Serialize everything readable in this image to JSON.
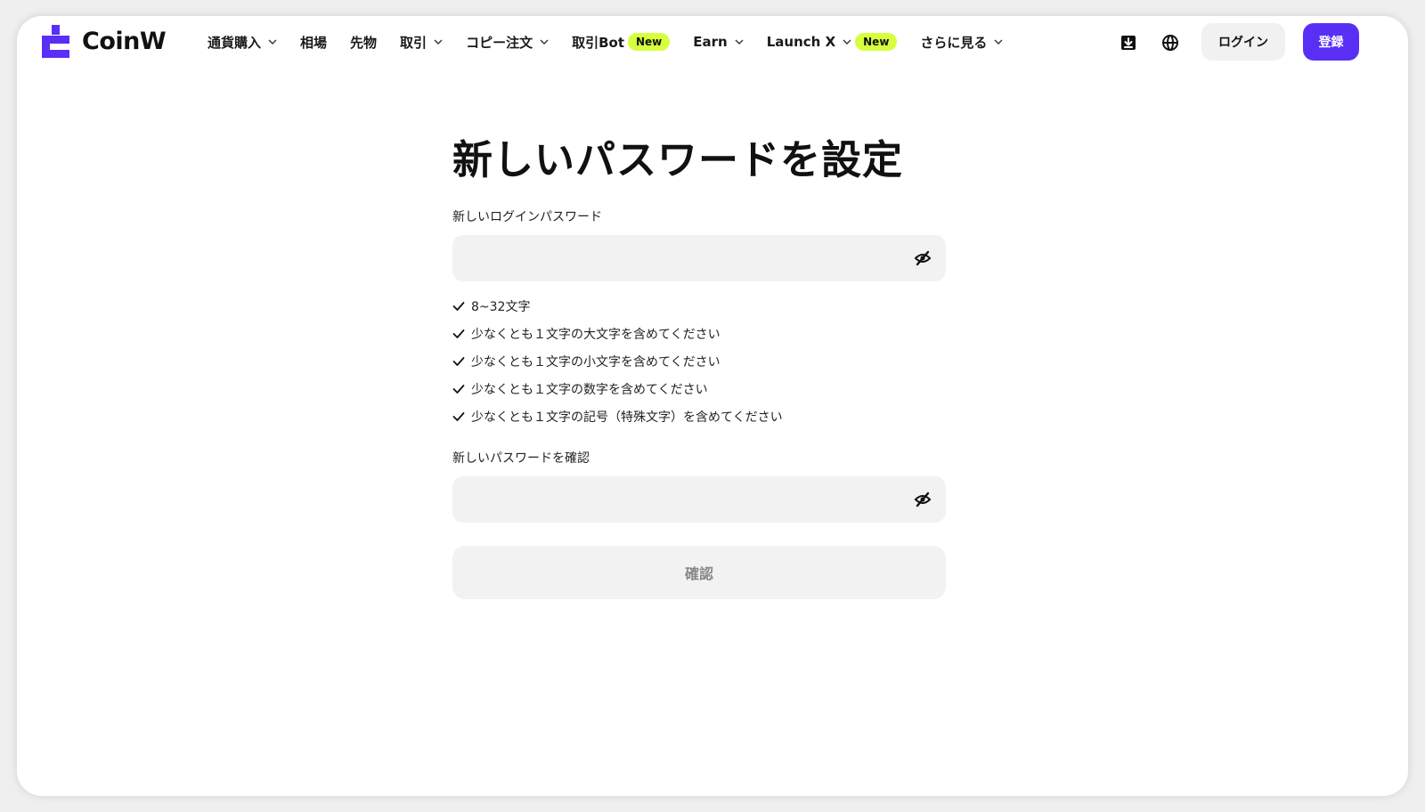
{
  "brand": {
    "name": "CoinW",
    "accent": "#5a2ff5",
    "badge_color": "#d6ff3d"
  },
  "nav": [
    {
      "label": "通貨購入",
      "dropdown": true
    },
    {
      "label": "相場",
      "dropdown": false
    },
    {
      "label": "先物",
      "dropdown": false
    },
    {
      "label": "取引",
      "dropdown": true
    },
    {
      "label": "コピー注文",
      "dropdown": true
    },
    {
      "label": "取引Bot",
      "dropdown": false,
      "badge": "New"
    },
    {
      "label": "Earn",
      "dropdown": true
    },
    {
      "label": "Launch X",
      "dropdown": true,
      "badge": "New"
    },
    {
      "label": "さらに見る",
      "dropdown": true
    }
  ],
  "header": {
    "icons": [
      "download-icon",
      "globe-icon"
    ],
    "login_label": "ログイン",
    "register_label": "登録"
  },
  "form": {
    "title": "新しいパスワードを設定",
    "password_label": "新しいログインパスワード",
    "password_value": "",
    "rules": [
      "8~32文字",
      "少なくとも１文字の大文字を含めてください",
      "少なくとも１文字の小文字を含めてください",
      "少なくとも１文字の数字を含めてください",
      "少なくとも１文字の記号（特殊文字）を含めてください"
    ],
    "confirm_label": "新しいパスワードを確認",
    "confirm_value": "",
    "submit_label": "確認"
  }
}
